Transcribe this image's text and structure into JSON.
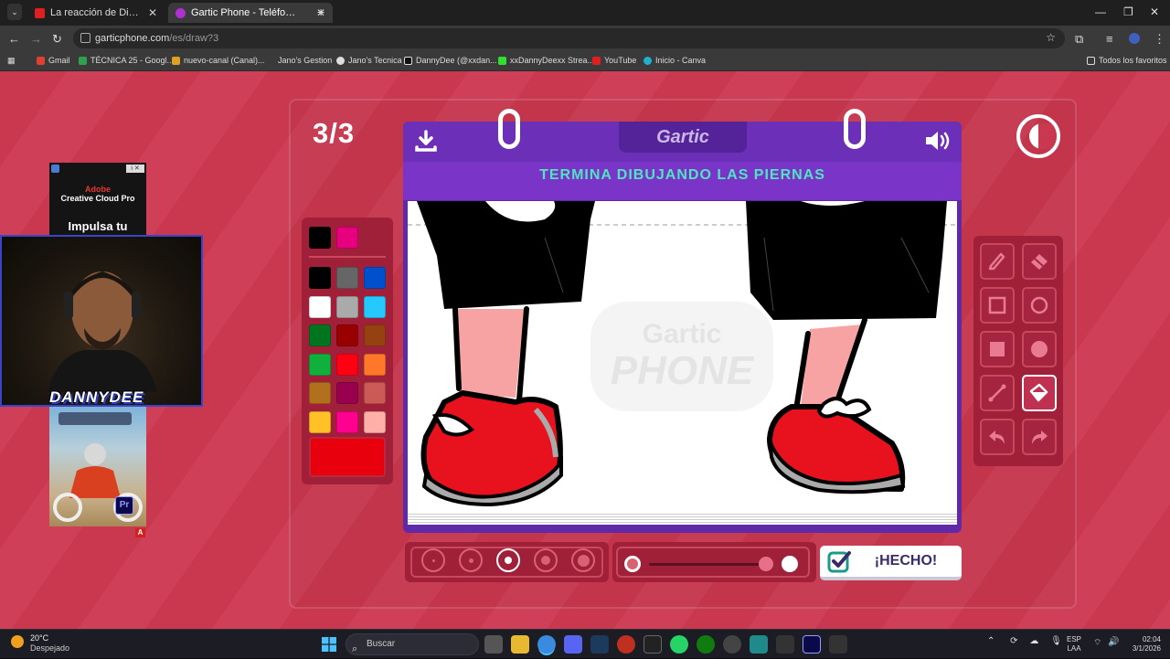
{
  "browser": {
    "tabs": [
      {
        "title": "La reacción de Dieguito Fernan"
      },
      {
        "title": "Gartic Phone - Teléfono Descon"
      }
    ],
    "url_domain": "garticphone.com",
    "url_path": "/es/draw?3",
    "bookmarks": [
      "Gmail",
      "TÉCNICA 25 - Googl...",
      "nuevo-canal (Canal)...",
      "Jano's Gestion",
      "Jano's Tecnica",
      "DannyDee (@xxdan...",
      "xxDannyDeexx Strea...",
      "YouTube",
      "Inicio - Canva",
      "Todos los favoritos"
    ]
  },
  "game": {
    "round": "3/3",
    "logo": "Gartic",
    "prompt": "TERMINA DIBUJANDO LAS PIERNAS",
    "watermark_top": "Gartic",
    "watermark_bottom": "PHONE",
    "done_label": "¡HECHO!",
    "palette": {
      "active_colors": [
        "#000000",
        "#e6007e"
      ],
      "colors": [
        [
          "#000000",
          "#666666",
          "#0050cd"
        ],
        [
          "#ffffff",
          "#aaaaaa",
          "#26c9ff"
        ],
        [
          "#017420",
          "#990000",
          "#964112"
        ],
        [
          "#11b03c",
          "#ff0013",
          "#ff7829"
        ],
        [
          "#b0701c",
          "#99004e",
          "#cb5a57"
        ],
        [
          "#ffc126",
          "#ff008f",
          "#feafa8"
        ]
      ],
      "current": "#e8000d"
    },
    "tools": [
      "pencil-tool",
      "eraser-tool",
      "rectangle-tool",
      "ellipse-tool",
      "filled-rectangle-tool",
      "filled-ellipse-tool",
      "line-tool",
      "fill-bucket-tool",
      "undo-tool",
      "redo-tool"
    ],
    "selected_tool": "fill-bucket-tool",
    "brush_sizes": 5,
    "selected_size": 3
  },
  "ad": {
    "brand": "Adobe",
    "product": "Creative Cloud Pro",
    "tagline": "Impulsa tu",
    "info": "i ✕",
    "pr_badge": "Pr",
    "ad_marker": "A"
  },
  "webcam": {
    "overlay": "DANNYDEE"
  },
  "taskbar": {
    "temp": "20°C",
    "condition": "Despejado",
    "search_placeholder": "Buscar",
    "lang_top": "ESP",
    "lang_bottom": "LAA",
    "time": "02:04",
    "date": "3/1/2026"
  }
}
